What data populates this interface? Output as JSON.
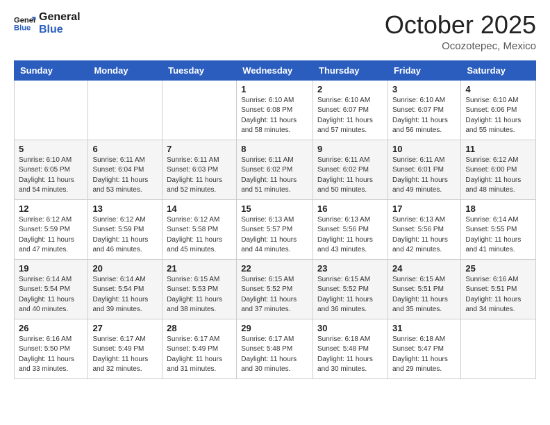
{
  "header": {
    "logo_general": "General",
    "logo_blue": "Blue",
    "month": "October 2025",
    "location": "Ocozotepec, Mexico"
  },
  "days_of_week": [
    "Sunday",
    "Monday",
    "Tuesday",
    "Wednesday",
    "Thursday",
    "Friday",
    "Saturday"
  ],
  "weeks": [
    [
      {
        "day": "",
        "info": ""
      },
      {
        "day": "",
        "info": ""
      },
      {
        "day": "",
        "info": ""
      },
      {
        "day": "1",
        "info": "Sunrise: 6:10 AM\nSunset: 6:08 PM\nDaylight: 11 hours\nand 58 minutes."
      },
      {
        "day": "2",
        "info": "Sunrise: 6:10 AM\nSunset: 6:07 PM\nDaylight: 11 hours\nand 57 minutes."
      },
      {
        "day": "3",
        "info": "Sunrise: 6:10 AM\nSunset: 6:07 PM\nDaylight: 11 hours\nand 56 minutes."
      },
      {
        "day": "4",
        "info": "Sunrise: 6:10 AM\nSunset: 6:06 PM\nDaylight: 11 hours\nand 55 minutes."
      }
    ],
    [
      {
        "day": "5",
        "info": "Sunrise: 6:10 AM\nSunset: 6:05 PM\nDaylight: 11 hours\nand 54 minutes."
      },
      {
        "day": "6",
        "info": "Sunrise: 6:11 AM\nSunset: 6:04 PM\nDaylight: 11 hours\nand 53 minutes."
      },
      {
        "day": "7",
        "info": "Sunrise: 6:11 AM\nSunset: 6:03 PM\nDaylight: 11 hours\nand 52 minutes."
      },
      {
        "day": "8",
        "info": "Sunrise: 6:11 AM\nSunset: 6:02 PM\nDaylight: 11 hours\nand 51 minutes."
      },
      {
        "day": "9",
        "info": "Sunrise: 6:11 AM\nSunset: 6:02 PM\nDaylight: 11 hours\nand 50 minutes."
      },
      {
        "day": "10",
        "info": "Sunrise: 6:11 AM\nSunset: 6:01 PM\nDaylight: 11 hours\nand 49 minutes."
      },
      {
        "day": "11",
        "info": "Sunrise: 6:12 AM\nSunset: 6:00 PM\nDaylight: 11 hours\nand 48 minutes."
      }
    ],
    [
      {
        "day": "12",
        "info": "Sunrise: 6:12 AM\nSunset: 5:59 PM\nDaylight: 11 hours\nand 47 minutes."
      },
      {
        "day": "13",
        "info": "Sunrise: 6:12 AM\nSunset: 5:59 PM\nDaylight: 11 hours\nand 46 minutes."
      },
      {
        "day": "14",
        "info": "Sunrise: 6:12 AM\nSunset: 5:58 PM\nDaylight: 11 hours\nand 45 minutes."
      },
      {
        "day": "15",
        "info": "Sunrise: 6:13 AM\nSunset: 5:57 PM\nDaylight: 11 hours\nand 44 minutes."
      },
      {
        "day": "16",
        "info": "Sunrise: 6:13 AM\nSunset: 5:56 PM\nDaylight: 11 hours\nand 43 minutes."
      },
      {
        "day": "17",
        "info": "Sunrise: 6:13 AM\nSunset: 5:56 PM\nDaylight: 11 hours\nand 42 minutes."
      },
      {
        "day": "18",
        "info": "Sunrise: 6:14 AM\nSunset: 5:55 PM\nDaylight: 11 hours\nand 41 minutes."
      }
    ],
    [
      {
        "day": "19",
        "info": "Sunrise: 6:14 AM\nSunset: 5:54 PM\nDaylight: 11 hours\nand 40 minutes."
      },
      {
        "day": "20",
        "info": "Sunrise: 6:14 AM\nSunset: 5:54 PM\nDaylight: 11 hours\nand 39 minutes."
      },
      {
        "day": "21",
        "info": "Sunrise: 6:15 AM\nSunset: 5:53 PM\nDaylight: 11 hours\nand 38 minutes."
      },
      {
        "day": "22",
        "info": "Sunrise: 6:15 AM\nSunset: 5:52 PM\nDaylight: 11 hours\nand 37 minutes."
      },
      {
        "day": "23",
        "info": "Sunrise: 6:15 AM\nSunset: 5:52 PM\nDaylight: 11 hours\nand 36 minutes."
      },
      {
        "day": "24",
        "info": "Sunrise: 6:15 AM\nSunset: 5:51 PM\nDaylight: 11 hours\nand 35 minutes."
      },
      {
        "day": "25",
        "info": "Sunrise: 6:16 AM\nSunset: 5:51 PM\nDaylight: 11 hours\nand 34 minutes."
      }
    ],
    [
      {
        "day": "26",
        "info": "Sunrise: 6:16 AM\nSunset: 5:50 PM\nDaylight: 11 hours\nand 33 minutes."
      },
      {
        "day": "27",
        "info": "Sunrise: 6:17 AM\nSunset: 5:49 PM\nDaylight: 11 hours\nand 32 minutes."
      },
      {
        "day": "28",
        "info": "Sunrise: 6:17 AM\nSunset: 5:49 PM\nDaylight: 11 hours\nand 31 minutes."
      },
      {
        "day": "29",
        "info": "Sunrise: 6:17 AM\nSunset: 5:48 PM\nDaylight: 11 hours\nand 30 minutes."
      },
      {
        "day": "30",
        "info": "Sunrise: 6:18 AM\nSunset: 5:48 PM\nDaylight: 11 hours\nand 30 minutes."
      },
      {
        "day": "31",
        "info": "Sunrise: 6:18 AM\nSunset: 5:47 PM\nDaylight: 11 hours\nand 29 minutes."
      },
      {
        "day": "",
        "info": ""
      }
    ]
  ]
}
